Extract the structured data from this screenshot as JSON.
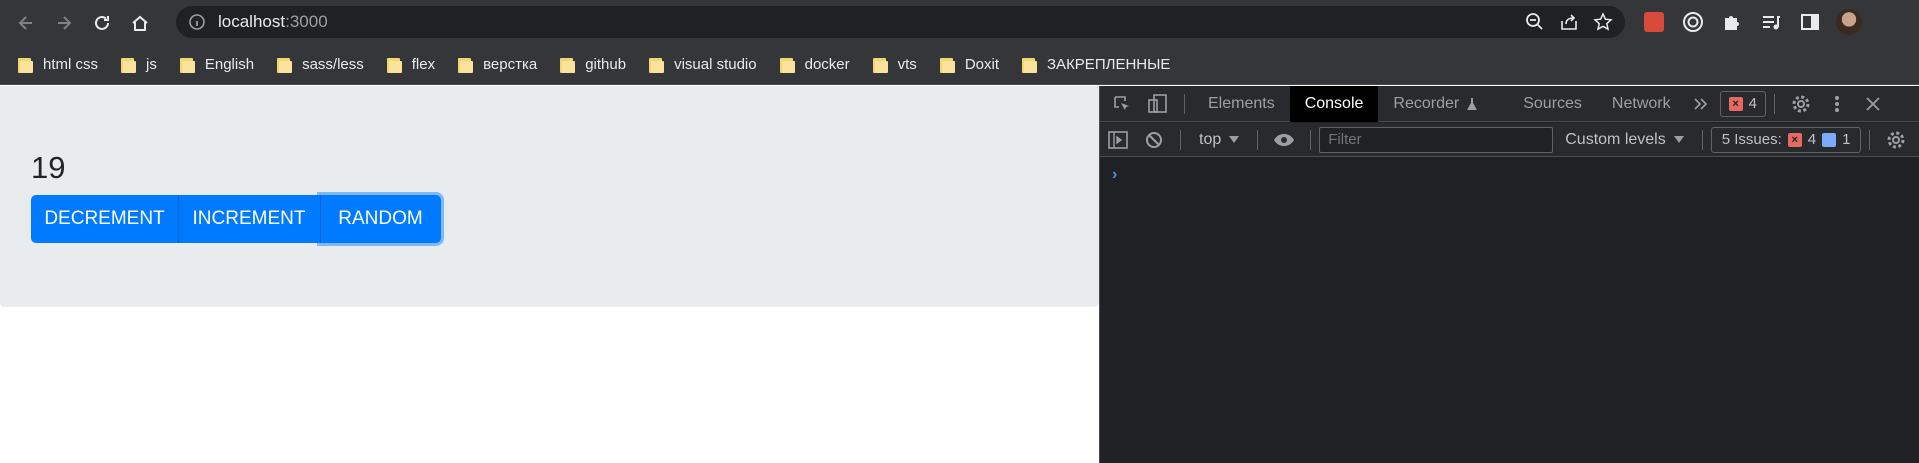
{
  "browser": {
    "url_host": "localhost",
    "url_port": ":3000",
    "bookmarks": [
      "html css",
      "js",
      "English",
      "sass/less",
      "flex",
      "верстка",
      "github",
      "visual studio",
      "docker",
      "vts",
      "Doxit",
      "ЗАКРЕПЛЕННЫЕ"
    ]
  },
  "app": {
    "counter": "19",
    "buttons": {
      "decrement": "DECREMENT",
      "increment": "INCREMENT",
      "random": "RANDOM"
    },
    "accent_color": "#007bff"
  },
  "devtools": {
    "tabs": [
      "Elements",
      "Console",
      "Recorder",
      "Sources",
      "Network"
    ],
    "active_tab": "Console",
    "error_count": "4",
    "context": "top",
    "filter_placeholder": "Filter",
    "levels_label": "Custom levels",
    "issues_label": "5 Issues:",
    "issues_errors": "4",
    "issues_info": "1",
    "prompt_symbol": "›"
  }
}
